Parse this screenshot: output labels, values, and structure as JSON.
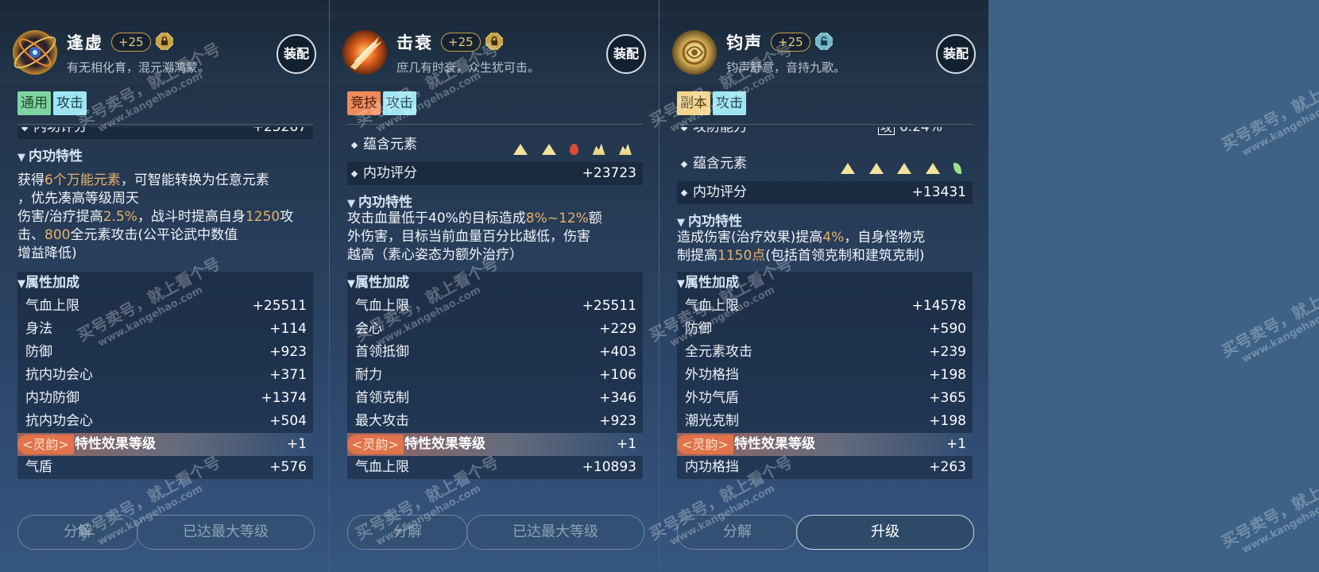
{
  "panels": [
    {
      "name": "逢虚",
      "level": "+25",
      "desc": "有无相化育，混元溯鸿蒙。",
      "equip_label": "装配",
      "tags": [
        "通用",
        "攻击"
      ],
      "partial_row": {
        "label": "内功评分",
        "value": "+25267"
      },
      "trait_title": "内功特性",
      "trait_lines": [
        {
          "pre": "获得",
          "hl": "6个万能元素",
          "post": "，可智能转换为任意元素"
        },
        {
          "pre": "，优先凑高等级周天",
          "hl": "",
          "post": ""
        },
        {
          "pre": "伤害/治疗提高",
          "hl": "2.5%",
          "post": "，战斗时提高自身"
        },
        {
          "pre": "",
          "hl": "1250",
          "post": "攻击、"
        },
        {
          "pre": "",
          "hl": "800",
          "post": "全元素攻击(公平论武中数值"
        },
        {
          "pre": "增益降低)",
          "hl": "",
          "post": ""
        }
      ],
      "attr_title": "属性加成",
      "attrs": [
        {
          "label": "气血上限",
          "value": "+25511"
        },
        {
          "label": "身法",
          "value": "+114"
        },
        {
          "label": "防御",
          "value": "+923"
        },
        {
          "label": "抗内功会心",
          "value": "+371"
        },
        {
          "label": "内功防御",
          "value": "+1374"
        },
        {
          "label": "抗内功会心",
          "value": "+504"
        }
      ],
      "lingyun": {
        "badge": "<灵韵>",
        "label": "特性效果等级",
        "value": "+1"
      },
      "last_attr": {
        "label": "气盾",
        "value": "+576"
      },
      "btn_left": "分解",
      "btn_right": "已达最大等级",
      "tag_colors": [
        "green",
        "cyan"
      ]
    },
    {
      "name": "击衰",
      "level": "+25",
      "desc": "庶几有时衰，众生犹可击。",
      "equip_label": "装配",
      "tags": [
        "竞技",
        "攻击"
      ],
      "elements_label": "蕴含元素",
      "score": {
        "label": "内功评分",
        "value": "+23723"
      },
      "trait_title": "内功特性",
      "trait_lines": [
        {
          "pre": "攻击血量低于40%的目标造成",
          "hl": "8%~12%",
          "post": "额"
        },
        {
          "pre": "外伤害，目标当前血量百分比越低，伤害",
          "hl": "",
          "post": ""
        },
        {
          "pre": "越高（素心姿态为额外治疗）",
          "hl": "",
          "post": ""
        }
      ],
      "attr_title": "属性加成",
      "attrs": [
        {
          "label": "气血上限",
          "value": "+25511"
        },
        {
          "label": "会心",
          "value": "+229"
        },
        {
          "label": "首领抵御",
          "value": "+403"
        },
        {
          "label": "耐力",
          "value": "+106"
        },
        {
          "label": "首领克制",
          "value": "+346"
        },
        {
          "label": "最大攻击",
          "value": "+923"
        }
      ],
      "lingyun": {
        "badge": "<灵韵>",
        "label": "特性效果等级",
        "value": "+1"
      },
      "last_attr": {
        "label": "气血上限",
        "value": "+10893"
      },
      "btn_left": "分解",
      "btn_right": "已达最大等级",
      "tag_colors": [
        "orange",
        "cyan"
      ]
    },
    {
      "name": "钧声",
      "level": "+25",
      "desc": "钧声舒意，音持九歌。",
      "equip_label": "装配",
      "tags": [
        "副本",
        "攻击"
      ],
      "partial_row": {
        "label": "攻防能力",
        "box": "攻",
        "value": "6.24%"
      },
      "elements_label": "蕴含元素",
      "score": {
        "label": "内功评分",
        "value": "+13431"
      },
      "trait_title": "内功特性",
      "trait_lines": [
        {
          "pre": "造成伤害(治疗效果)提高",
          "hl": "4%",
          "post": "，自身怪物克"
        },
        {
          "pre": "制提高",
          "hl": "1150点",
          "post": "(包括首领克制和建筑克制)"
        }
      ],
      "attr_title": "属性加成",
      "attrs": [
        {
          "label": "气血上限",
          "value": "+14578"
        },
        {
          "label": "防御",
          "value": "+590"
        },
        {
          "label": "全元素攻击",
          "value": "+239"
        },
        {
          "label": "外功格挡",
          "value": "+198"
        },
        {
          "label": "外功气盾",
          "value": "+365"
        },
        {
          "label": "潮光克制",
          "value": "+198"
        }
      ],
      "lingyun": {
        "badge": "<灵韵>",
        "label": "特性效果等级",
        "value": "+1"
      },
      "last_attr": {
        "label": "内功格挡",
        "value": "+263"
      },
      "btn_left": "分解",
      "btn_right": "升级",
      "tag_colors": [
        "gold",
        "cyan"
      ]
    }
  ],
  "watermark": {
    "text": "买号卖号，就上看个号",
    "url": "www.kangehao.com",
    "badge": "看个号"
  }
}
